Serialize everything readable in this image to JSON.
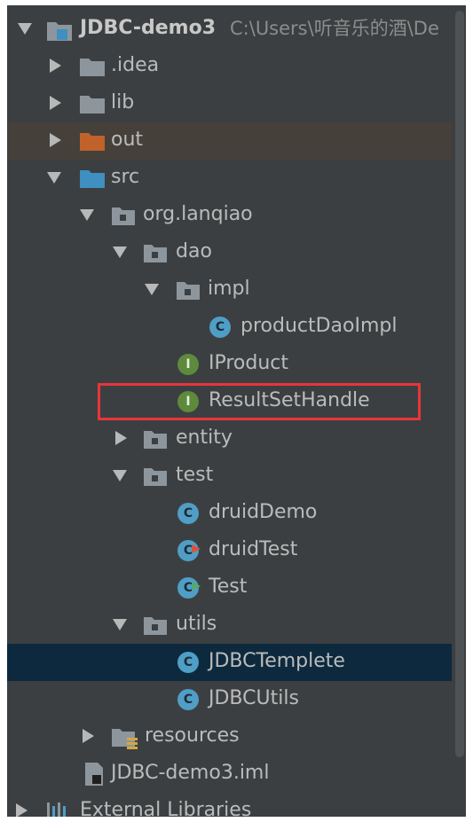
{
  "project": {
    "name": "JDBC-demo3",
    "path": "C:\\Users\\听音乐的酒\\De"
  },
  "tree": {
    "idea": ".idea",
    "lib": "lib",
    "out": "out",
    "src": "src",
    "package": "org.lanqiao",
    "dao": "dao",
    "impl": "impl",
    "productDaoImpl": "productDaoImpl",
    "iproduct": "IProduct",
    "resultSetHandle": "ResultSetHandle",
    "entity": "entity",
    "test": "test",
    "druidDemo": "druidDemo",
    "druidTest": "druidTest",
    "testClass": "Test",
    "utils": "utils",
    "jdbcTemplete": "JDBCTemplete",
    "jdbcUtils": "JDBCUtils",
    "resources": "resources",
    "iml": "JDBC-demo3.iml",
    "externalLibraries": "External Libraries"
  },
  "icons": {
    "class_letter": "C",
    "interface_letter": "I"
  },
  "colors": {
    "panel_bg": "#3c3f41",
    "selected_row": "#0d293e",
    "highlight_box": "#e8353a",
    "out_folder": "#c0622a",
    "source_folder": "#3f8fc0"
  }
}
